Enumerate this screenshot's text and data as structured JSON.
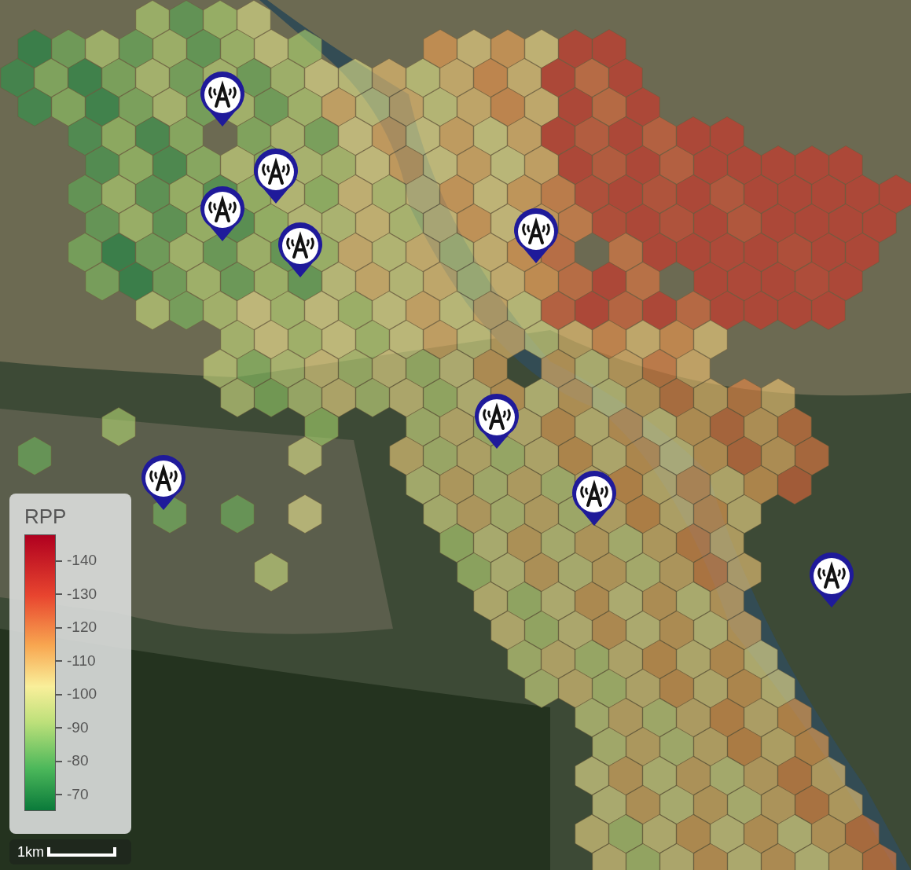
{
  "legend": {
    "title": "RPP",
    "ticks": [
      "-140",
      "-130",
      "-120",
      "-110",
      "-100",
      "-90",
      "-80",
      "-70"
    ]
  },
  "scale_bar": {
    "label": "1km"
  }
}
